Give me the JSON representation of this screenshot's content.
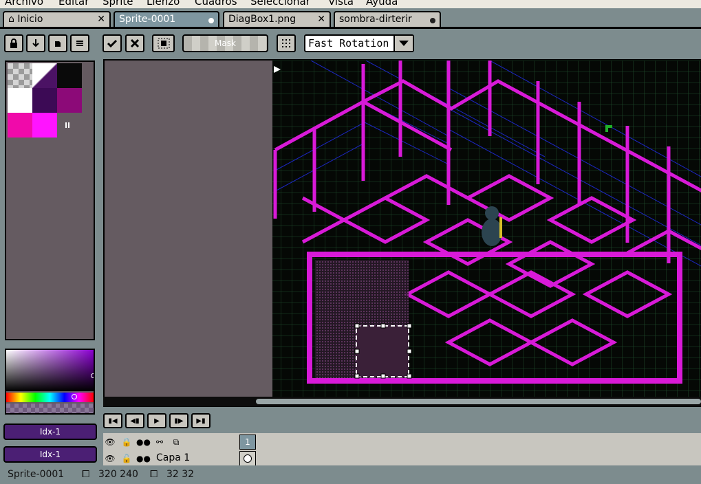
{
  "menu": [
    "Archivo",
    "Editar",
    "Sprite",
    "Lienzo",
    "Cuadros",
    "Seleccionar",
    "Vista",
    "Ayuda"
  ],
  "tabs": [
    {
      "label": "Inicio",
      "active": false
    },
    {
      "label": "Sprite-0001",
      "active": true
    },
    {
      "label": "DiagBox1.png",
      "active": false
    },
    {
      "label": "sombra-dirterir",
      "active": false
    }
  ],
  "toolbar": {
    "mask_label": "Mask",
    "rotation_select": {
      "value": "Fast Rotation"
    }
  },
  "palette": {
    "colors": [
      "#ffffff",
      "#4b1264",
      "#0a0a0a",
      "#ffffff",
      "#3c0a55",
      "#8c0a78",
      "#f00aaa",
      "#ff14ff"
    ]
  },
  "color_indices": {
    "foreground": "Idx-1",
    "background": "Idx-1"
  },
  "timeline": {
    "layers": [
      {
        "name": "Capa 1"
      }
    ],
    "frames": [
      "1"
    ]
  },
  "status": {
    "sprite_name": "Sprite-0001",
    "size": "320 240",
    "grid": "32 32"
  }
}
